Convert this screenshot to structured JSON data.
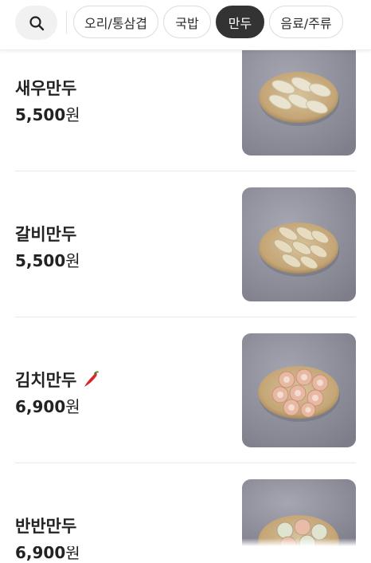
{
  "categories": [
    {
      "label": "오리/통삼겹",
      "active": false
    },
    {
      "label": "국밥",
      "active": false
    },
    {
      "label": "만두",
      "active": true
    },
    {
      "label": "음료/주류",
      "active": false
    }
  ],
  "menu": [
    {
      "name": "새우만두",
      "price": "5,500",
      "currency": "원",
      "spicy": false,
      "dumpling": "shrimp-dumpling"
    },
    {
      "name": "갈비만두",
      "price": "5,500",
      "currency": "원",
      "spicy": false,
      "dumpling": "galbi-dumpling"
    },
    {
      "name": "김치만두",
      "price": "6,900",
      "currency": "원",
      "spicy": true,
      "spicy_icon": "chili-pepper-icon",
      "dumpling": "kimchi-dumpling"
    },
    {
      "name": "반반만두",
      "price": "6,900",
      "currency": "원",
      "spicy": false,
      "dumpling": "half-half-dumpling"
    }
  ],
  "colors": {
    "active_chip": "#333333",
    "photo_bg": "#8f8f9a",
    "plate": "#c9a97c"
  }
}
